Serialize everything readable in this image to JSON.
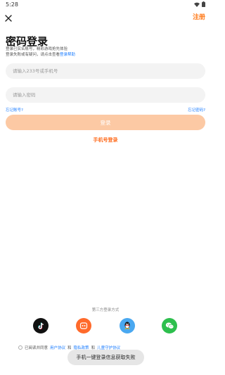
{
  "status_bar": {
    "time": "5:28"
  },
  "header": {
    "register_label": "注册"
  },
  "title": "密码登录",
  "description": {
    "line1": "登录已实名账号，精彩游戏抢先体验",
    "line2_prefix": "登录失败或有疑问，请点击查看",
    "help_link": "登录帮助"
  },
  "form": {
    "phone_placeholder": "请输入233号或手机号",
    "password_placeholder": "请输入密码",
    "forgot_account": "忘记账号?",
    "forgot_password": "忘记密码?",
    "login_label": "登录",
    "phone_login_label": "手机号登录"
  },
  "third_party": {
    "label": "第三方登录方式",
    "providers": [
      "tiktok-icon",
      "app233-icon",
      "qq-icon",
      "wechat-icon"
    ]
  },
  "agreement": {
    "prefix": "已阅读并同意",
    "user_agreement": "用户协议",
    "and1": "和",
    "privacy_policy": "隐私政策",
    "and2": "和",
    "child_protection": "儿童守护协议"
  },
  "toast": "手机一键登录信息获取失败",
  "colors": {
    "accent": "#ff7a1a",
    "link": "#1a7cff",
    "button_disabled": "#fcc9a4"
  }
}
